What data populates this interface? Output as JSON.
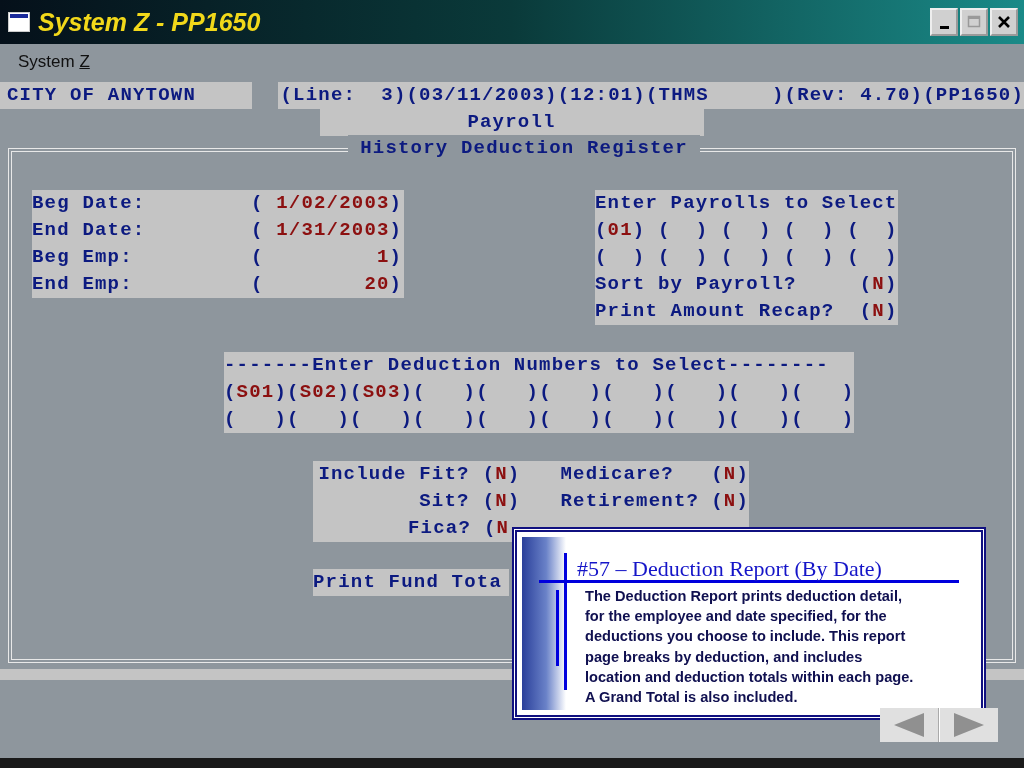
{
  "window": {
    "title": "System Z - PP1650"
  },
  "menu": [
    {
      "label": "System ",
      "access_key": "Z"
    }
  ],
  "header": {
    "company": "CITY OF ANYTOWN",
    "status": "(Line:  3)(03/11/2003)(12:01)(THMS     )(Rev: 4.70)(PP1650)",
    "module": "Payroll"
  },
  "screen_title": "History Deduction Register",
  "range_fields": [
    {
      "label": "Beg Date:",
      "field": "( 1/02/2003)"
    },
    {
      "label": "End Date:",
      "field": "( 1/31/2003)"
    },
    {
      "label": "Beg Emp:",
      "field": "(         1)"
    },
    {
      "label": "End Emp:",
      "field": "(        20)"
    }
  ],
  "payrolls": {
    "heading": "Enter Payrolls to Select",
    "rows": [
      [
        "(01)",
        "(  )",
        "(  )",
        "(  )",
        "(  )"
      ],
      [
        "(  )",
        "(  )",
        "(  )",
        "(  )",
        "(  )"
      ]
    ],
    "options": [
      {
        "label": "Sort by Payroll?",
        "field": "(N)"
      },
      {
        "label": "Print Amount Recap?",
        "field": "(N)"
      }
    ]
  },
  "deductions": {
    "heading": "-------Enter Deduction Numbers to Select--------",
    "rows": [
      [
        "(S01)",
        "(S02)",
        "(S03)",
        "(   )",
        "(   )",
        "(   )",
        "(   )",
        "(   )",
        "(   )",
        "(   )"
      ],
      [
        "(   )",
        "(   )",
        "(   )",
        "(   )",
        "(   )",
        "(   )",
        "(   )",
        "(   )",
        "(   )",
        "(   )"
      ]
    ]
  },
  "includes": [
    [
      {
        "label": "Include Fit?",
        "field": "(N)"
      },
      {
        "label": "Medicare?",
        "field": "(N)"
      }
    ],
    [
      {
        "label": "Sit?",
        "field": "(N)"
      },
      {
        "label": "Retirement?",
        "field": "(N)"
      }
    ],
    [
      {
        "label": "Fica?",
        "field": "(N",
        "partial": true
      }
    ]
  ],
  "fund_total": {
    "label": "Print Fund Tota"
  },
  "callout": {
    "title": "#57 – Deduction Report (By Date)",
    "body": "The Deduction Report prints deduction detail,\nfor the employee and date specified, for the\ndeductions you choose to include.  This report\npage breaks by deduction, and includes\nlocation and deduction totals within each page.\nA Grand Total is also included."
  }
}
